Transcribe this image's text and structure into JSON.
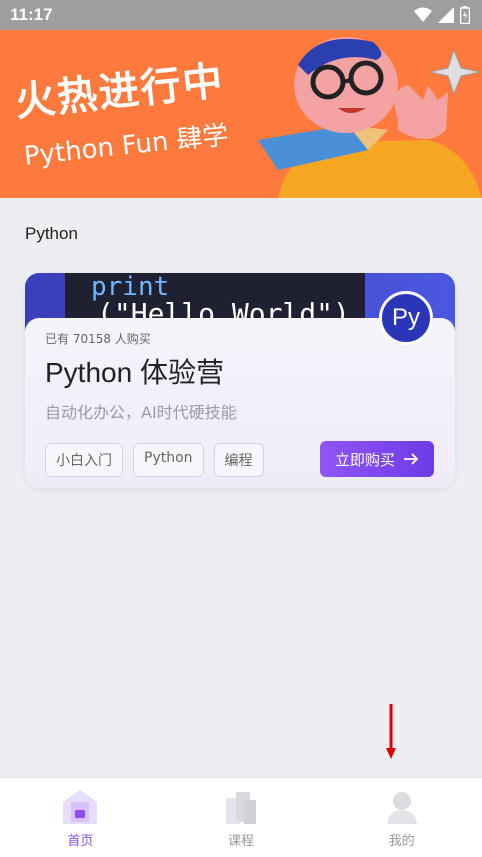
{
  "status_bar": {
    "time": "11:17"
  },
  "banner": {
    "title": "火热进行中",
    "subtitle": "Python Fun 肆学"
  },
  "section": {
    "title": "Python"
  },
  "course": {
    "image_text_1": "print",
    "image_text_2": "(\"Hello World\")",
    "avatar_text": "Py",
    "buyers": "已有 70158 人购买",
    "title": "Python 体验营",
    "description": "自动化办公，AI时代硬技能",
    "tags": [
      "小白入门",
      "Python",
      "编程"
    ],
    "buy_label": "立即购买"
  },
  "bottom_nav": {
    "items": [
      {
        "label": "首页",
        "icon": "home-icon",
        "active": true
      },
      {
        "label": "课程",
        "icon": "courses-icon",
        "active": false
      },
      {
        "label": "我的",
        "icon": "profile-icon",
        "active": false
      }
    ]
  },
  "colors": {
    "accent": "#8d4cf0",
    "banner": "#ff7a3c",
    "arrow": "#e00000"
  }
}
